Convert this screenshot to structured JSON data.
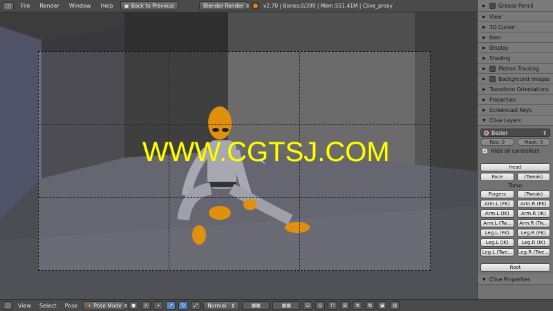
{
  "topbar": {
    "menus": [
      "File",
      "Render",
      "Window",
      "Help"
    ],
    "back_button": "Back to Previous",
    "render_engine": "Blender Render",
    "info": "v2.70 | Bones:0/399 | Mem:551.41M | Clive_proxy"
  },
  "viewport": {
    "watermark": "WWW.CGTSJ.COM"
  },
  "panel": {
    "grease_pencil": "Grease Pencil",
    "sections": [
      "View",
      "3D Cursor",
      "Item",
      "Display",
      "Shading",
      "Motion Tracking",
      "Background Images",
      "Transform Orientations",
      "Properties",
      "Screencast Keys",
      "Clive Layers"
    ],
    "interp_select": "Bezier",
    "res_label": "Res:",
    "res_value": "0",
    "mask_label": "Mask:",
    "mask_value": "0",
    "hide_controllers": "Hide all controllers",
    "head_label": "head",
    "face_btn": "Face",
    "tweak_btn": "(Tweak)",
    "torso_label": "Torso",
    "fingers_btn": "Fingers",
    "fingers_tweak_btn": "(Tweak)",
    "limb_buttons": [
      [
        "Arm.L (FK)",
        "Arm.R (FK)"
      ],
      [
        "Arm.L (IK)",
        "Arm.R (IK)"
      ],
      [
        "Arm.L (Tw...",
        "Arm.R (Tw..."
      ],
      [
        "Leg.L (FK)",
        "Leg.R (FK)"
      ],
      [
        "Leg.L (IK)",
        "Leg.R (IK)"
      ],
      [
        "Leg.L (Twe...",
        "Leg.R (Twe..."
      ]
    ],
    "root_btn": "Root",
    "clive_properties": "Clive Properties"
  },
  "bottombar": {
    "menus": [
      "View",
      "Select",
      "Pose"
    ],
    "mode": "Pose Mode",
    "orientation": "Normal"
  },
  "colors": {
    "accent": "#e87d0d",
    "watermark": "#ffff00",
    "selected_icon": "#5680c2"
  }
}
